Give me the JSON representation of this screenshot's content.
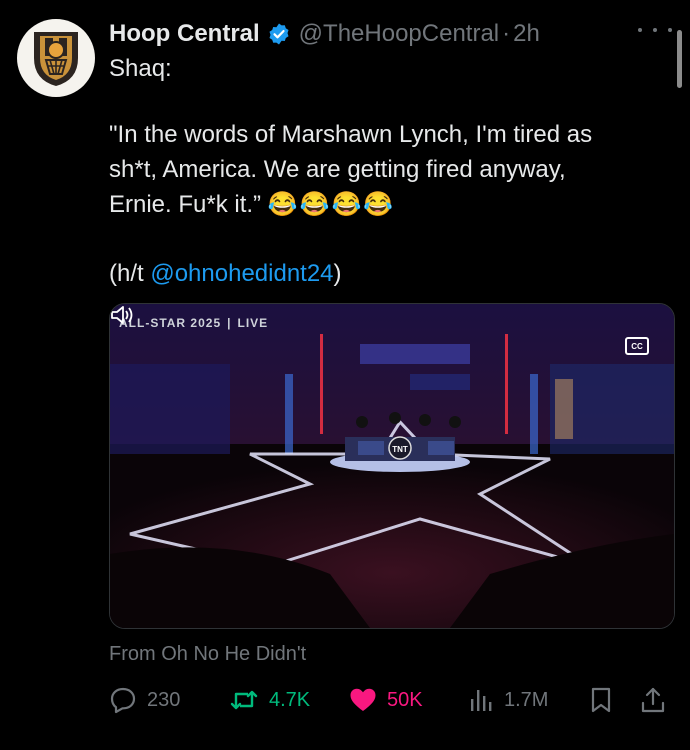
{
  "tweet": {
    "author": {
      "name": "Hoop Central",
      "handle": "@TheHoopCentral",
      "separator": "·",
      "time": "2h",
      "verified": true
    },
    "body": {
      "line1": "Shaq:",
      "line2": "\"In the words of Marshawn Lynch, I'm tired as",
      "line3": "sh*t, America. We are getting fired anyway,",
      "line4": "Ernie. Fu*k it.”",
      "emojis": "😂😂😂😂",
      "ht_prefix": "(h/t ",
      "mention": "@ohnohedidnt24",
      "ht_suffix": ")"
    },
    "media": {
      "overlay_event": "ALL-STAR 2025",
      "overlay_divider": "|",
      "overlay_live": "LIVE",
      "cc_label": "CC",
      "desk_logo": "TNT"
    },
    "source": "From Oh No He Didn't",
    "stats": {
      "replies": "230",
      "reposts": "4.7K",
      "likes": "50K",
      "views": "1.7M"
    }
  },
  "colors": {
    "background": "#000000",
    "text": "#e7e9ea",
    "muted": "#71767b",
    "link": "#1d9bf0",
    "repost": "#00ba7c",
    "like": "#f91880",
    "verified": "#1d9bf0"
  },
  "icons": {
    "avatar": "hoop-central-logo",
    "verified": "verified-badge-icon",
    "more": "more-options-icon",
    "reply": "reply-icon",
    "repost": "repost-icon",
    "like": "heart-icon",
    "views": "views-chart-icon",
    "bookmark": "bookmark-icon",
    "share": "share-icon",
    "cc": "closed-captions-icon",
    "sound": "sound-muted-icon"
  }
}
